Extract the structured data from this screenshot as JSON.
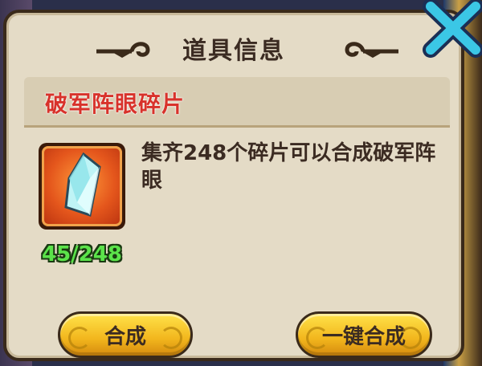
{
  "dialog": {
    "title": "道具信息",
    "item_name": "破军阵眼碎片",
    "description": "集齐248个碎片可以合成破军阵眼",
    "count": "45/248",
    "buttons": {
      "compose": "合成",
      "one_key_compose": "一键合成"
    }
  },
  "icons": {
    "close": "close-x-icon",
    "item": "crystal-shard-icon",
    "ornament": "swirl-ornament-icon"
  },
  "colors": {
    "item_name": "#d8322b",
    "count": "#5be34a",
    "button": "#f2b61d",
    "close": "#3bc7e6"
  }
}
